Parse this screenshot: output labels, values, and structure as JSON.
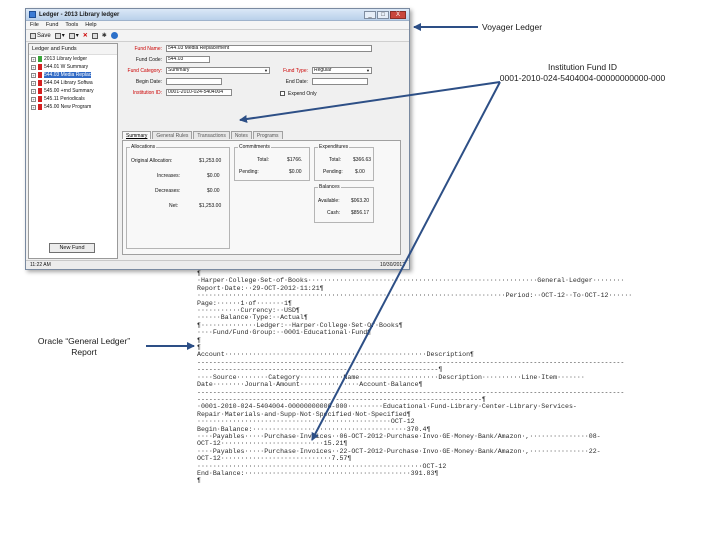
{
  "window": {
    "title": "Ledger - 2013 Library ledger",
    "controls": [
      "_",
      "□",
      "X"
    ],
    "menu": [
      "File",
      "Fund",
      "Tools",
      "Help"
    ],
    "toolbar": {
      "save_label": "Save"
    },
    "tree": {
      "header": "Ledger and Funds",
      "items": [
        {
          "label": "2013 Library ledger",
          "flag": "green",
          "selected": false
        },
        {
          "label": "544.01 W Summary",
          "flag": "red",
          "selected": false
        },
        {
          "label": "544.03 Media Replac",
          "flag": "red",
          "selected": true
        },
        {
          "label": "544.04 Library Softwa",
          "flag": "red",
          "selected": false
        },
        {
          "label": "545.00 +rnd Summary",
          "flag": "red",
          "selected": false
        },
        {
          "label": "545.11 Periodicals",
          "flag": "red",
          "selected": false
        },
        {
          "label": "545.00 New Program",
          "flag": "red",
          "selected": false
        }
      ],
      "new_fund_button": "New Fund"
    },
    "form": {
      "fund_name_label": "Fund Name:",
      "fund_name": "544.03 Media Replacement",
      "fund_code_label": "Fund Code:",
      "fund_code": "544.03",
      "fund_category_label": "Fund Category:",
      "fund_category": "Summary",
      "fund_type_label": "Fund Type:",
      "fund_type": "Regular",
      "begin_date_label": "Begin Date:",
      "end_date_label": "End Date:",
      "institution_id_label": "Institution ID:",
      "institution_id": "0001-2010-024-5404004",
      "expend_only_label": "Expend Only"
    },
    "tabs": [
      "Summary",
      "General Rules",
      "Transactions",
      "Notes",
      "Programs"
    ],
    "allocations": {
      "title": "Allocations",
      "rows": [
        {
          "label": "Original Allocation:",
          "value": "$1,253.00"
        },
        {
          "label": "Increases:",
          "value": "$0.00"
        },
        {
          "label": "Decreases:",
          "value": "$0.00"
        },
        {
          "label": "Net:",
          "value": "$1,253.00"
        }
      ]
    },
    "commitments": {
      "title": "Commitments",
      "total_label": "Total:",
      "total": "$1766.",
      "pending_label": "Pending:",
      "pending": "$0.00"
    },
    "expenditures": {
      "title": "Expenditures",
      "total_label": "Total:",
      "total": "$366.63",
      "pending_label": "Pending:",
      "pending": "$.00"
    },
    "balances": {
      "title": "Balances",
      "available_label": "Available:",
      "available": "$063.20",
      "cash_label": "Cash:",
      "cash": "$856.17"
    },
    "status": {
      "left": "11:22 AM",
      "right": "10/30/2012"
    }
  },
  "callouts": {
    "voyager": "Voyager Ledger",
    "institution_line1": "Institution Fund ID",
    "institution_line2": "0001-2010-024-5404004-00000000000-000",
    "oracle_line1": "Oracle “General Ledger”",
    "oracle_line2": "Report"
  },
  "report": {
    "lines": [
      "¶",
      "·Harper·College·Set·of·Books··························································General·Ledger········",
      "Report·Date:··29-OCT-2012·11:21¶",
      "··············································································Period:··OCT-12··To·OCT-12······",
      "Page:······1·of·······1¶",
      "···········Currency:··USD¶",
      "······Balance·Type:··Actual¶",
      "¶··············Ledger:··Harper·College·Set·Of·Books¶",
      "····Fund/Fund·Group:··0001·Educational·Fund¶",
      "¶",
      "¶",
      "Account···················································Description¶",
      "------------------------------------------------------------------------------------------------------------",
      "-------------------------------------------------------------¶",
      "····Source········Category···········Name····················Description··········Line·Item·······",
      "Date········Journal·Amount···············Account·Balance¶",
      "------------------------------------------------------------------------------------------------------------",
      "------------------------------------------------------------------------¶",
      "·0001-2010-024-5404004-00000000000-000·········Educational·Fund-Library·Center-Library·Services-",
      "Repair·Materials·and·Supp·Not·Specified·Not·Specified¶",
      "·················································OCT-12",
      "Begin·Balance:·······································370.4¶",
      "····Payables·····Purchase·Invoices··06-OCT-2012·Purchase·Invo·GE·Money·Bank/Amazon·,···············08-",
      "OCT-12··························15.21¶",
      "····Payables·····Purchase·Invoices··22-OCT-2012·Purchase·Invo·GE·Money·Bank/Amazon·,···············22-",
      "OCT-12····························7.57¶",
      "·························································OCT-12",
      "End·Balance:··········································391.83¶",
      "¶"
    ]
  },
  "colors": {
    "accent": "#316ac5",
    "flag_red": "#d42020",
    "flag_green": "#3aa53a",
    "required_label": "#cc0000"
  },
  "icons": [
    "app-icon",
    "save-icon",
    "new-icon",
    "copy-icon",
    "delete-icon",
    "print-icon",
    "star-icon",
    "globe-icon",
    "expand-icon",
    "flag-icon",
    "dropdown-icon"
  ]
}
